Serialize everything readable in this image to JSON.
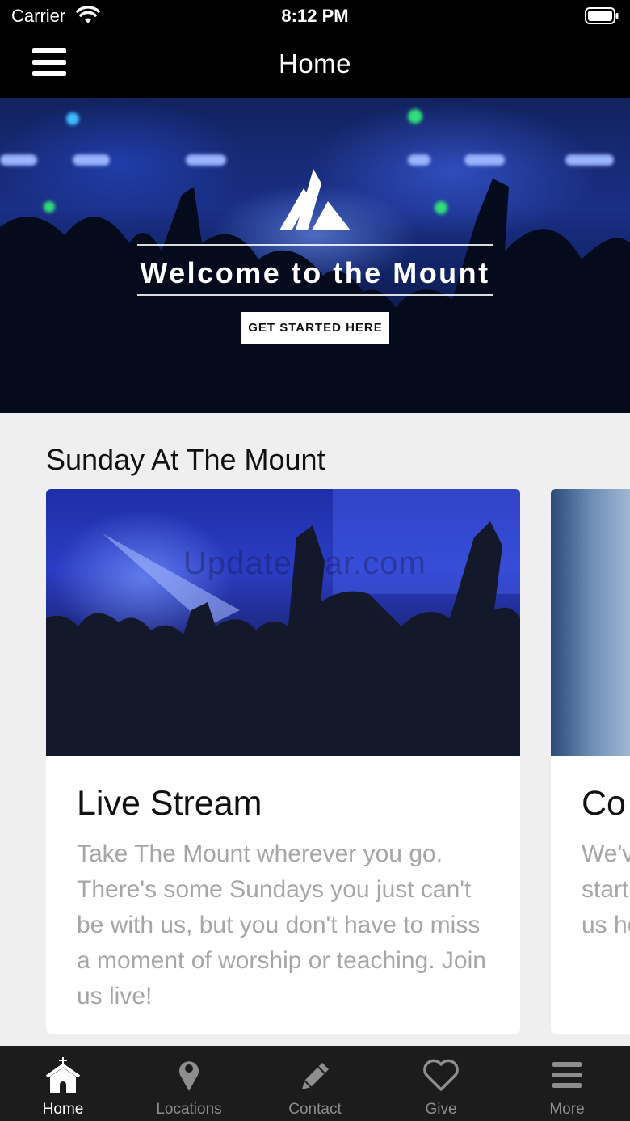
{
  "status_bar": {
    "carrier": "Carrier",
    "time": "8:12 PM"
  },
  "nav": {
    "title": "Home"
  },
  "hero": {
    "title": "Welcome to the Mount",
    "button_label": "GET STARTED HERE"
  },
  "section": {
    "title": "Sunday At The Mount"
  },
  "cards": [
    {
      "title": "Live Stream",
      "description": "Take The Mount wherever you go. There's some Sundays you just can't be with us, but you don't have to miss a moment of worship or teaching. Join us live!",
      "watermark": "UpdateStar.com"
    },
    {
      "title": "Co",
      "description_lines": [
        "We'v",
        "start",
        "us he"
      ]
    }
  ],
  "tabs": [
    {
      "label": "Home",
      "icon": "church-icon",
      "active": true
    },
    {
      "label": "Locations",
      "icon": "map-pin-icon",
      "active": false
    },
    {
      "label": "Contact",
      "icon": "pencil-icon",
      "active": false
    },
    {
      "label": "Give",
      "icon": "heart-icon",
      "active": false
    },
    {
      "label": "More",
      "icon": "menu-icon",
      "active": false
    }
  ],
  "colors": {
    "bar_background": "#000000",
    "tab_bar_background": "#1c1c1c",
    "tab_active": "#ffffff",
    "tab_inactive": "#8e8e8e",
    "page_background": "#efefef",
    "description_text": "#a6a6a6"
  }
}
